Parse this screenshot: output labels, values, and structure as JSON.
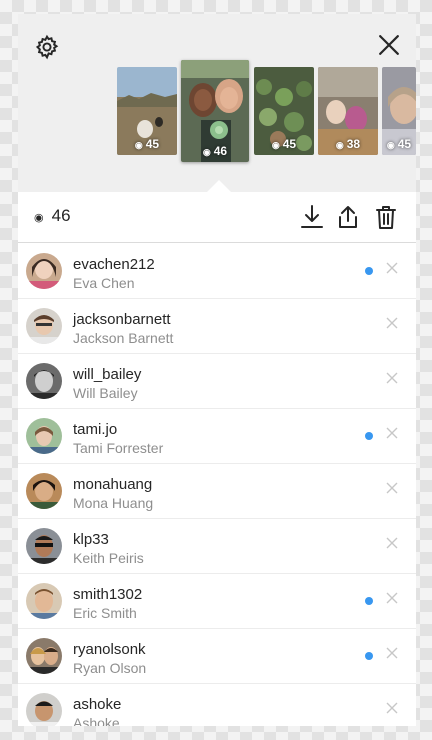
{
  "story_tray": {
    "thumbnails": [
      {
        "count": "45",
        "selected": false
      },
      {
        "count": "46",
        "selected": true
      },
      {
        "count": "45",
        "selected": false
      },
      {
        "count": "38",
        "selected": false
      },
      {
        "count": "45",
        "selected": false
      }
    ]
  },
  "viewers": {
    "total": "46"
  },
  "viewer_list": [
    {
      "username": "evachen212",
      "full_name": "Eva Chen",
      "unseen": true
    },
    {
      "username": "jacksonbarnett",
      "full_name": "Jackson Barnett",
      "unseen": false
    },
    {
      "username": "will_bailey",
      "full_name": "Will Bailey",
      "unseen": false
    },
    {
      "username": "tami.jo",
      "full_name": "Tami Forrester",
      "unseen": true
    },
    {
      "username": "monahuang",
      "full_name": "Mona Huang",
      "unseen": false
    },
    {
      "username": "klp33",
      "full_name": "Keith Peiris",
      "unseen": false
    },
    {
      "username": "smith1302",
      "full_name": "Eric Smith",
      "unseen": true
    },
    {
      "username": "ryanolsonk",
      "full_name": "Ryan Olson",
      "unseen": true
    },
    {
      "username": "ashoke",
      "full_name": "Ashoke",
      "unseen": false
    }
  ],
  "colors": {
    "accent_dot": "#3897f0",
    "text_primary": "#262626",
    "text_secondary": "#8e8e8e"
  },
  "icons": {
    "settings": "gear-icon",
    "close": "close-icon",
    "download": "download-icon",
    "share": "share-icon",
    "delete": "trash-icon",
    "views": "eye-icon",
    "remove_viewer": "close-icon"
  }
}
